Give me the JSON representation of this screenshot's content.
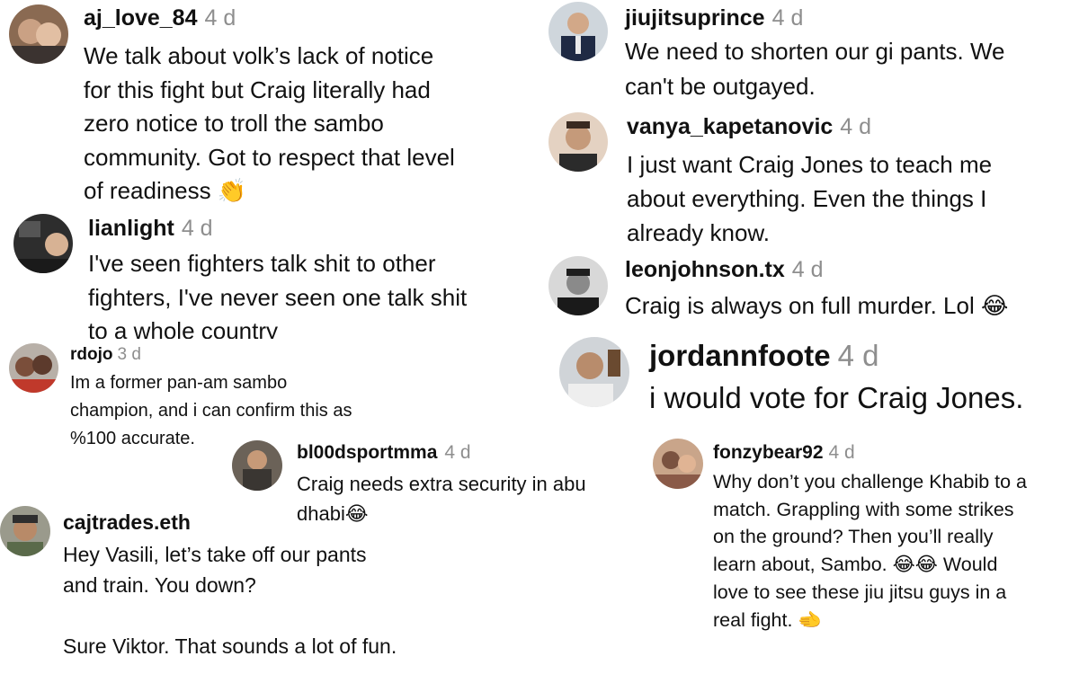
{
  "comments": [
    {
      "id": "c1",
      "username": "aj_love_84",
      "time": "4 d",
      "text": "We talk about volk’s lack of notice\nfor this fight but Craig literally had\nzero notice to troll the sambo\ncommunity. Got to respect that level\nof readiness",
      "emoji": "👏",
      "avatar": "avatar-couple-photo"
    },
    {
      "id": "c2",
      "username": "lianlight",
      "time": "4 d",
      "text": "I've seen fighters talk shit to other\nfighters, I've never seen one talk shit\nto a whole country",
      "avatar": "avatar-selfie-photo"
    },
    {
      "id": "c3",
      "username": "rdojo",
      "time": "3 d",
      "text": "Im a former pan-am sambo\nchampion, and i can confirm this as\n%100 accurate.",
      "avatar": "avatar-couple-photo"
    },
    {
      "id": "c4",
      "username": "bl00dsportmma",
      "time": "4 d",
      "text": "Craig needs extra security in abu\ndhabi",
      "emoji": "😂",
      "avatar": "avatar-fighter-photo"
    },
    {
      "id": "c5",
      "username": "cajtrades.eth",
      "time": "",
      "text": "Hey Vasili, let’s take off our pants\nand train. You down?\n\nSure Viktor. That sounds a lot of fun.",
      "avatar": "avatar-man-cap-photo"
    },
    {
      "id": "c6",
      "username": "jiujitsuprince",
      "time": "4 d",
      "text": "We need to shorten our gi pants. We\ncan't be outgayed.",
      "avatar": "avatar-man-suit-photo"
    },
    {
      "id": "c7",
      "username": "vanya_kapetanovic",
      "time": "4 d",
      "text": "I just want Craig Jones to teach me\nabout everything. Even the things I\nalready know.",
      "avatar": "avatar-portrait-photo"
    },
    {
      "id": "c8",
      "username": "leonjohnson.tx",
      "time": "4 d",
      "text": "Craig is always on full murder. Lol",
      "emoji": "😂",
      "avatar": "avatar-man-cap-bw-photo"
    },
    {
      "id": "c9",
      "username": "jordannfoote",
      "time": "4 d",
      "text": "i would vote for Craig Jones.",
      "avatar": "avatar-man-photo"
    },
    {
      "id": "c10",
      "username": "fonzybear92",
      "time": "4 d",
      "text": "Why don’t you challenge Khabib to a\nmatch. Grappling with some strikes\non the ground? Then you’ll really\nlearn about, Sambo.",
      "emoji_mid": "😂😂",
      "text_after": " Would\nlove to see these jiu jitsu guys in a\nreal fight.",
      "emoji": "🫲",
      "avatar": "avatar-group-photo"
    }
  ]
}
